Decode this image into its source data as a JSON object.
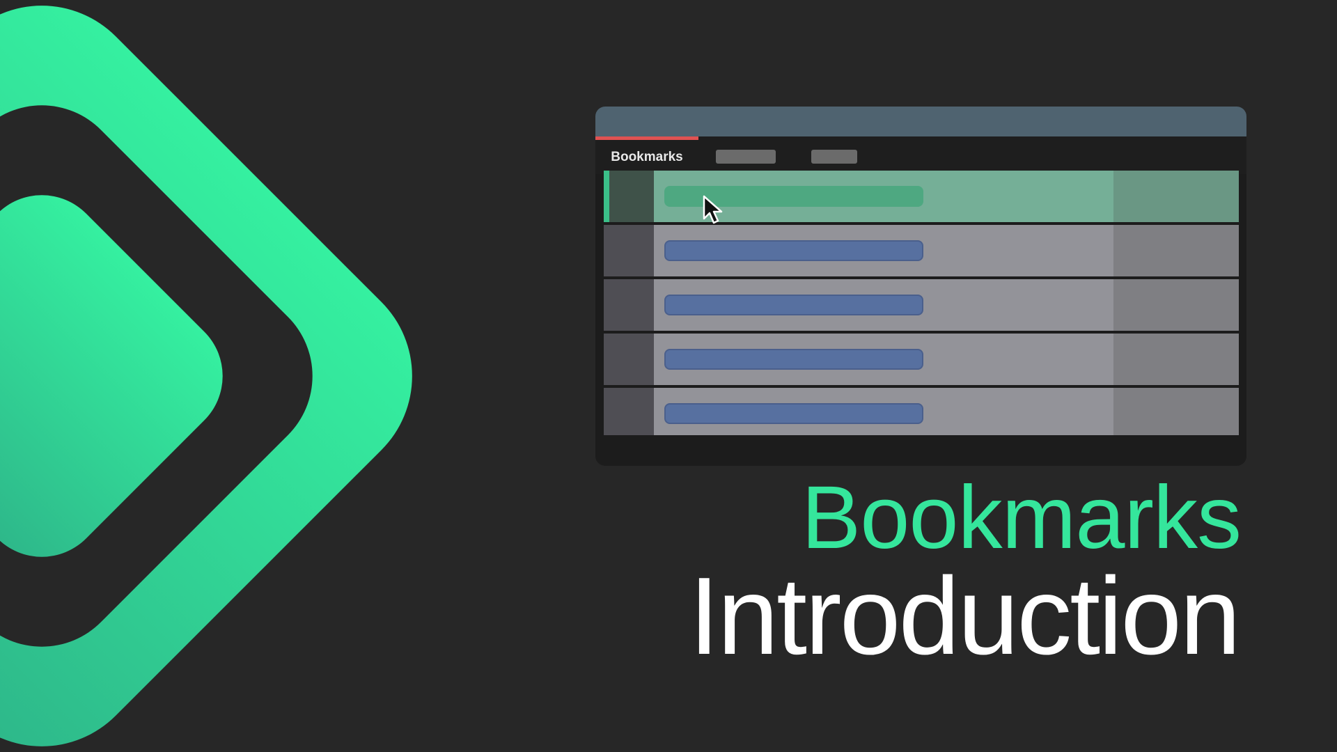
{
  "logo": {
    "icon": "diamond-logo-icon",
    "colors": [
      "#35f0a0",
      "#2eb88a"
    ]
  },
  "window": {
    "tabs": [
      {
        "label": "Bookmarks",
        "active": true
      }
    ],
    "rows_count": 5,
    "selected_row": 0
  },
  "heading": {
    "line1": "Bookmarks",
    "line2": "Introduction"
  },
  "colors": {
    "accent_green": "#35e69c",
    "active_tab_indicator": "#e05252",
    "row_pill": "#5770a0"
  }
}
